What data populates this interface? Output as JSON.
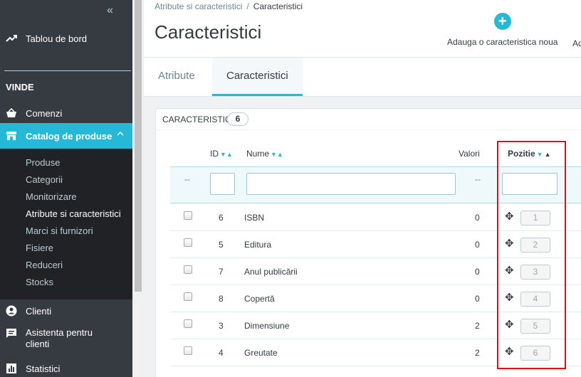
{
  "sidebar": {
    "collapse_icon": "double-chevron-left",
    "dashboard": "Tablou de bord",
    "section": "VINDE",
    "orders": "Comenzi",
    "catalog": "Catalog de produse",
    "catalog_sub": [
      "Produse",
      "Categorii",
      "Monitorizare",
      "Atribute si caracteristici",
      "Marci si furnizori",
      "Fisiere",
      "Reduceri",
      "Stocks"
    ],
    "customers": "Clienti",
    "support": "Asistenta pentru clienti",
    "stats": "Statistici"
  },
  "header": {
    "breadcrumb_parent": "Atribute si caracteristici",
    "breadcrumb_separator": "/",
    "breadcrumb_current": "Caracteristici",
    "title": "Caracteristici",
    "add_button_label": "Adauga o caracteristica noua",
    "add_button2_label": "Ad",
    "tabs": [
      "Atribute",
      "Caracteristici"
    ]
  },
  "panel": {
    "title": "Caracteristici",
    "count": "6",
    "columns": {
      "id": "ID",
      "name": "Nume",
      "values": "Valori",
      "position": "Pozitie"
    },
    "filter_dash_left": "--",
    "filter_dash_values": "--",
    "rows": [
      {
        "id": "6",
        "name": "ISBN",
        "values": "0",
        "position": "1"
      },
      {
        "id": "5",
        "name": "Editura",
        "values": "0",
        "position": "2"
      },
      {
        "id": "7",
        "name": "Anul publicării",
        "values": "0",
        "position": "3"
      },
      {
        "id": "8",
        "name": "Copertă",
        "values": "0",
        "position": "4"
      },
      {
        "id": "3",
        "name": "Dimensiune",
        "values": "2",
        "position": "5"
      },
      {
        "id": "4",
        "name": "Greutate",
        "values": "2",
        "position": "6"
      }
    ]
  },
  "colors": {
    "accent": "#25b9d7",
    "sidebar": "#363a41",
    "highlight": "#e30613"
  }
}
